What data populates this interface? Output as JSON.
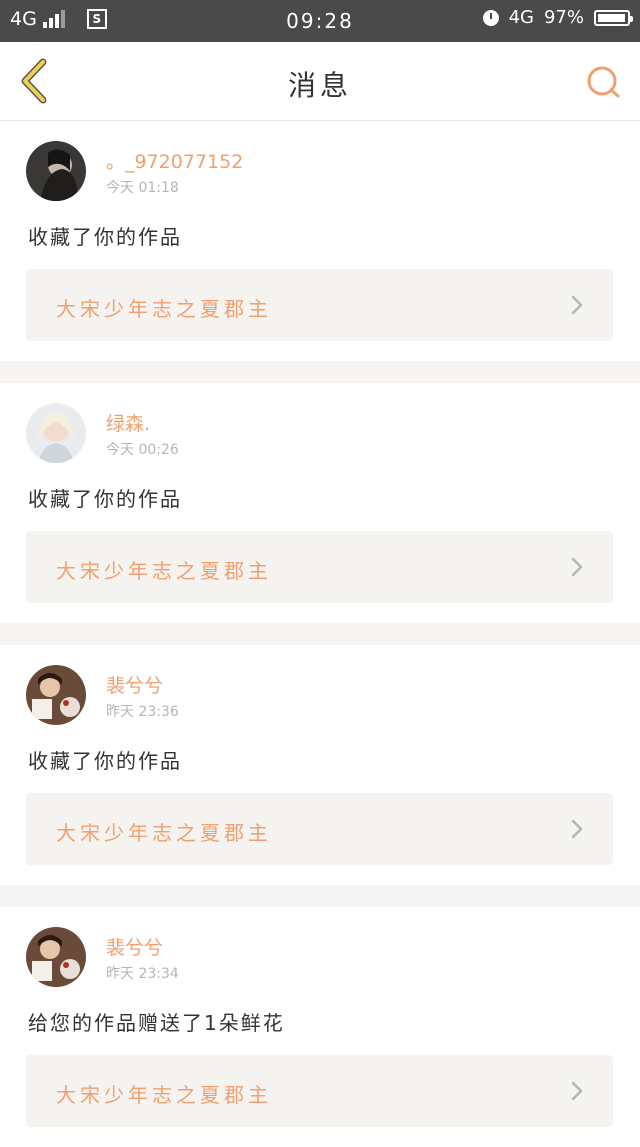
{
  "status_bar": {
    "network": "4G",
    "time": "09:28",
    "network_right": "4G",
    "battery": "97%",
    "battery_level": 0.97
  },
  "header": {
    "title": "消息"
  },
  "colors": {
    "accent": "#f0a070",
    "status_bar": "#4a4a4a",
    "card_link_bg": "#f4f3ef",
    "back_icon": "#f0d050"
  },
  "icons": {
    "back": "chevron-left-icon",
    "search": "search-icon",
    "arrow": "chevron-right-icon"
  },
  "notifications": [
    {
      "user": "。_972077152",
      "time": "今天 01:18",
      "message": "收藏了你的作品",
      "work": "大宋少年志之夏郡主"
    },
    {
      "user": "绿森.",
      "time": "今天 00:26",
      "message": "收藏了你的作品",
      "work": "大宋少年志之夏郡主"
    },
    {
      "user": "裴兮兮",
      "time": "昨天 23:36",
      "message": "收藏了你的作品",
      "work": "大宋少年志之夏郡主"
    },
    {
      "user": "裴兮兮",
      "time": "昨天 23:34",
      "message": "给您的作品赠送了1朵鲜花",
      "work": "大宋少年志之夏郡主"
    }
  ]
}
